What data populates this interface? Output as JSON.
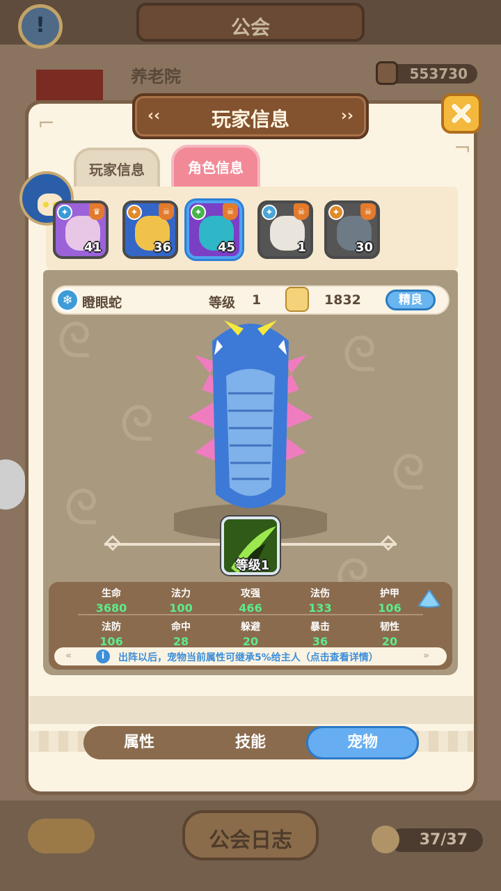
{
  "background": {
    "title": "公会",
    "guild_name": "养老院",
    "guild_score": "553730",
    "log_button": "公会日志",
    "member_count": "37/37"
  },
  "modal": {
    "title": "玩家信息",
    "tabs": [
      {
        "label": "玩家信息",
        "active": false
      },
      {
        "label": "角色信息",
        "active": true
      }
    ]
  },
  "roles": [
    {
      "level": "41",
      "color": "#e8c7e6",
      "frame": "#9b62d9",
      "badge": "crown",
      "selected": false
    },
    {
      "level": "36",
      "color": "#f1c24a",
      "frame": "#3466c7",
      "badge": "skull",
      "selected": false
    },
    {
      "level": "45",
      "color": "#2fb6c7",
      "frame": "#7b3fc5",
      "badge": "skull",
      "selected": true
    },
    {
      "level": "1",
      "color": "#e9e4dc",
      "frame": "#555555",
      "badge": "skull",
      "selected": false
    },
    {
      "level": "30",
      "color": "#6e7b86",
      "frame": "#555555",
      "badge": "skull",
      "selected": false
    }
  ],
  "pet": {
    "name": "瞪眼蛇",
    "level_label": "等级",
    "level": "1",
    "power": "1832",
    "quality": "精良",
    "skill_level": "等级1"
  },
  "stats": [
    {
      "name": "生命",
      "value": "3680"
    },
    {
      "name": "法力",
      "value": "100"
    },
    {
      "name": "攻强",
      "value": "466"
    },
    {
      "name": "法伤",
      "value": "133"
    },
    {
      "name": "护甲",
      "value": "106"
    },
    {
      "name": "法防",
      "value": "106"
    },
    {
      "name": "命中",
      "value": "28"
    },
    {
      "name": "躲避",
      "value": "20"
    },
    {
      "name": "暴击",
      "value": "36"
    },
    {
      "name": "韧性",
      "value": "20"
    }
  ],
  "tip": "出阵以后，宠物当前属性可继承5%给主人（点击查看详情）",
  "bottom_tabs": [
    {
      "label": "属性",
      "active": false
    },
    {
      "label": "技能",
      "active": false
    },
    {
      "label": "宠物",
      "active": true
    }
  ],
  "colors": {
    "accent_blue": "#66aef1",
    "stat_green": "#5cec8c",
    "panel_brown": "#8a6b4d"
  }
}
